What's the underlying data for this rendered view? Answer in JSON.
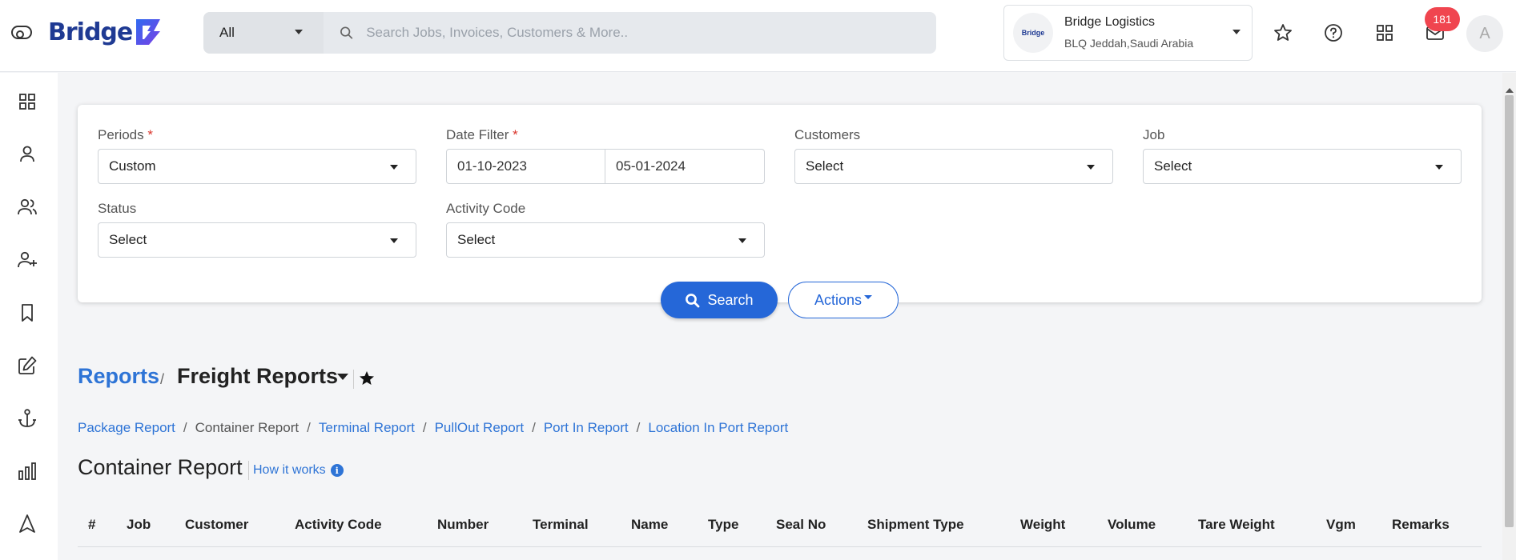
{
  "app": {
    "logo_text": "Bridge",
    "scope_value": "All",
    "search_placeholder": "Search Jobs, Invoices, Customers & More..",
    "company_name": "Bridge Logistics",
    "company_location": "BLQ Jeddah,Saudi Arabia",
    "company_logo_text": "Bridge",
    "notification_count": "181",
    "avatar_initial": "A"
  },
  "sidebar": {
    "icons": [
      "dashboard-icon",
      "user-icon",
      "users-icon",
      "user-plus-icon",
      "bookmark-icon",
      "edit-icon",
      "anchor-icon",
      "bar-chart-icon",
      "navigation-icon"
    ]
  },
  "filters": {
    "periods_label": "Periods",
    "periods_value": "Custom",
    "date_filter_label": "Date Filter",
    "date_from": "01-10-2023",
    "date_to": "05-01-2024",
    "customers_label": "Customers",
    "customers_value": "Select",
    "job_label": "Job",
    "job_value": "Select",
    "status_label": "Status",
    "status_value": "Select",
    "activity_code_label": "Activity Code",
    "activity_code_value": "Select",
    "required_mark": "*",
    "search_button": "Search",
    "actions_button": "Actions"
  },
  "breadcrumb": {
    "root": "Reports",
    "separator": "/",
    "current": "Freight Reports"
  },
  "sub_links": [
    {
      "label": "Package Report",
      "active": false
    },
    {
      "label": "Container Report",
      "active": true
    },
    {
      "label": "Terminal Report",
      "active": false
    },
    {
      "label": "PullOut Report",
      "active": false
    },
    {
      "label": "Port In Report",
      "active": false
    },
    {
      "label": "Location In Port Report",
      "active": false
    }
  ],
  "page": {
    "title": "Container Report",
    "how_it_works": "How it works",
    "info_glyph": "i"
  },
  "table": {
    "columns": [
      "#",
      "Job",
      "Customer",
      "Activity Code",
      "Number",
      "Terminal",
      "Name",
      "Type",
      "Seal No",
      "Shipment Type",
      "Weight",
      "Volume",
      "Tare Weight",
      "Vgm",
      "Remarks"
    ]
  },
  "colors": {
    "primary": "#2567d8",
    "link": "#2e74d6",
    "badge": "#f0454f",
    "required": "#d9342b"
  }
}
